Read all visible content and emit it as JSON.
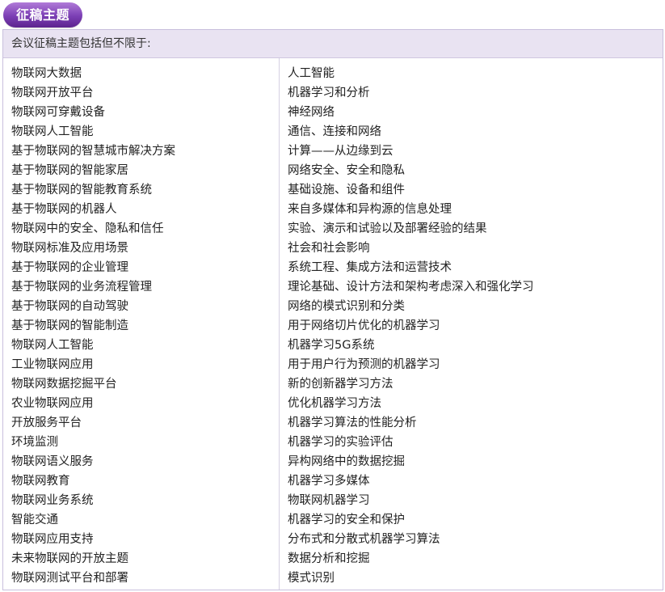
{
  "header": {
    "badge_label": "征稿主题"
  },
  "intro": "会议征稿主题包括但不限于:",
  "left_topics": [
    "物联网大数据",
    "物联网开放平台",
    "物联网可穿戴设备",
    "物联网人工智能",
    "基于物联网的智慧城市解决方案",
    "基于物联网的智能家居",
    "基于物联网的智能教育系统",
    "基于物联网的机器人",
    "物联网中的安全、隐私和信任",
    "物联网标准及应用场景",
    "基于物联网的企业管理",
    "基于物联网的业务流程管理",
    "基于物联网的自动驾驶",
    "基于物联网的智能制造",
    "物联网人工智能",
    "工业物联网应用",
    "物联网数据挖掘平台",
    "农业物联网应用",
    "开放服务平台",
    "环境监测",
    "物联网语义服务",
    "物联网教育",
    "物联网业务系统",
    "智能交通",
    "物联网应用支持",
    "未来物联网的开放主题",
    "物联网测试平台和部署"
  ],
  "right_topics": [
    "人工智能",
    "机器学习和分析",
    "神经网络",
    "通信、连接和网络",
    "计算——从边缘到云",
    "网络安全、安全和隐私",
    "基础设施、设备和组件",
    "来自多媒体和异构源的信息处理",
    "实验、演示和试验以及部署经验的结果",
    "社会和社会影响",
    "系统工程、集成方法和运营技术",
    "理论基础、设计方法和架构考虑深入和强化学习",
    "网络的模式识别和分类",
    "用于网络切片优化的机器学习",
    "机器学习5G系统",
    "用于用户行为预测的机器学习",
    "新的创新器学习方法",
    "优化机器学习方法",
    "机器学习算法的性能分析",
    "机器学习的实验评估",
    "异构网络中的数据挖掘",
    "机器学习多媒体",
    "物联网机器学习",
    "机器学习的安全和保护",
    "分布式和分散式机器学习算法",
    "数据分析和挖掘",
    "模式识别"
  ],
  "colors": {
    "badge_purple": "#7b3fb4",
    "intro_bg": "#e9e3f2",
    "border": "#c9c0dd"
  }
}
